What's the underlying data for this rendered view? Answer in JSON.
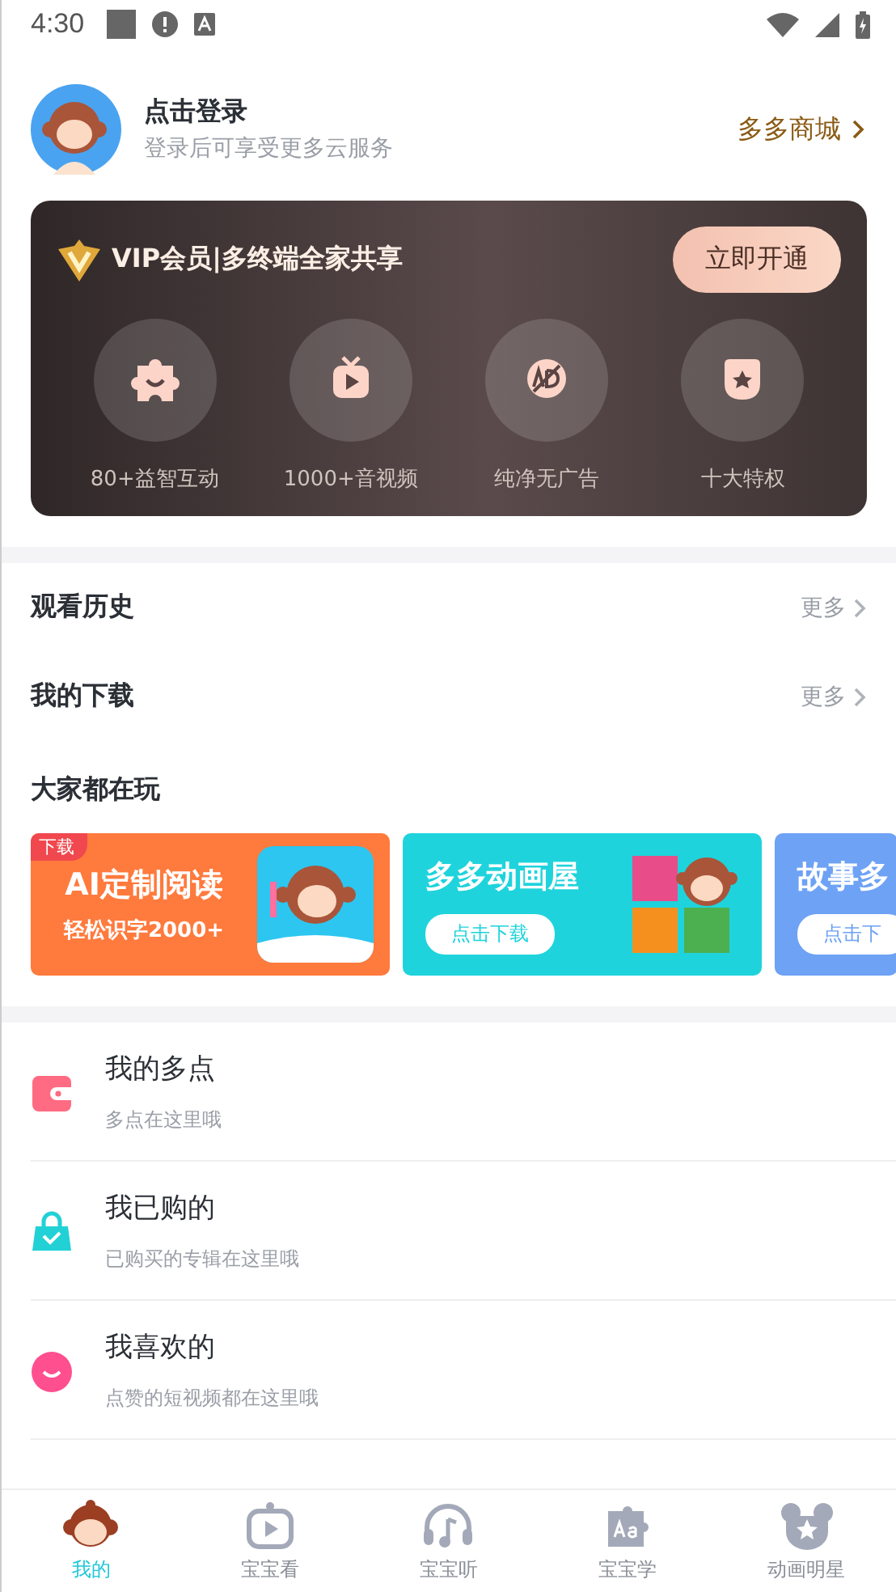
{
  "status_bar": {
    "time": "4:30"
  },
  "profile": {
    "title": "点击登录",
    "subtitle": "登录后可享受更多云服务",
    "shop_link": "多多商城"
  },
  "vip": {
    "title": "VIP会员|多终端全家共享",
    "button": "立即开通",
    "perks": [
      {
        "kind": "puzzle",
        "label": "80+益智互动"
      },
      {
        "kind": "video",
        "label": "1000+音视频"
      },
      {
        "kind": "noad",
        "label": "纯净无广告"
      },
      {
        "kind": "star",
        "label": "十大特权"
      }
    ]
  },
  "shortcuts": [
    {
      "label": "观看历史",
      "more": "更多"
    },
    {
      "label": "我的下载",
      "more": "更多"
    }
  ],
  "featured": {
    "title": "大家都在玩",
    "cards": [
      {
        "kind": "reading",
        "badge": "下载",
        "title": "AI定制阅读",
        "subtitle": "轻松识字2000+",
        "color": "#ff7a3d"
      },
      {
        "kind": "download",
        "title": "多多动画屋",
        "button": "点击下载",
        "color": "#1fd3dc"
      },
      {
        "kind": "download",
        "title": "故事多",
        "button": "点击下",
        "color": "#6ea2f5"
      }
    ]
  },
  "menu": [
    {
      "kind": "wallet",
      "title": "我的多点",
      "subtitle": "多点在这里哦"
    },
    {
      "kind": "bag",
      "title": "我已购的",
      "subtitle": "已购买的专辑在这里哦"
    },
    {
      "kind": "smile",
      "title": "我喜欢的",
      "subtitle": "点赞的短视频都在这里哦"
    }
  ],
  "tabs": [
    {
      "kind": "monkey",
      "label": "我的",
      "selected": true
    },
    {
      "kind": "tv",
      "label": "宝宝看",
      "selected": false
    },
    {
      "kind": "headphones",
      "label": "宝宝听",
      "selected": false
    },
    {
      "kind": "puzzle",
      "label": "宝宝学",
      "selected": false
    },
    {
      "kind": "bear",
      "label": "动画明星",
      "selected": false
    }
  ]
}
